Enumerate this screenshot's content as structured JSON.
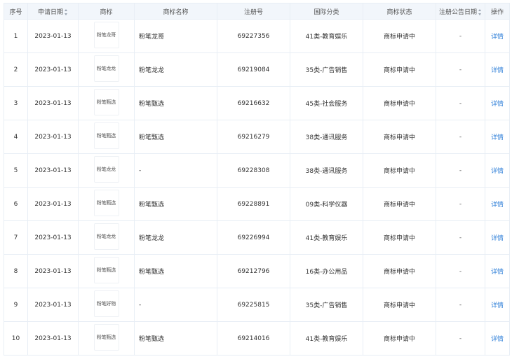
{
  "table": {
    "headers": {
      "index": "序号",
      "apply_date": "申请日期",
      "logo": "商标",
      "name": "商标名称",
      "reg_no": "注册号",
      "category": "国际分类",
      "status": "商标状态",
      "announce_date": "注册公告日期",
      "action": "操作"
    },
    "rows": [
      {
        "index": "1",
        "apply_date": "2023-01-13",
        "logo_text": "粉笔龙哥",
        "name": "粉笔龙哥",
        "reg_no": "69227356",
        "category": "41类-教育娱乐",
        "status": "商标申请中",
        "announce_date": "-",
        "action": "详情"
      },
      {
        "index": "2",
        "apply_date": "2023-01-13",
        "logo_text": "粉笔龙龙",
        "name": "粉笔龙龙",
        "reg_no": "69219084",
        "category": "35类-广告销售",
        "status": "商标申请中",
        "announce_date": "-",
        "action": "详情"
      },
      {
        "index": "3",
        "apply_date": "2023-01-13",
        "logo_text": "粉笔甄选",
        "name": "粉笔甄选",
        "reg_no": "69216632",
        "category": "45类-社会服务",
        "status": "商标申请中",
        "announce_date": "-",
        "action": "详情"
      },
      {
        "index": "4",
        "apply_date": "2023-01-13",
        "logo_text": "粉笔甄选",
        "name": "粉笔甄选",
        "reg_no": "69216279",
        "category": "38类-通讯服务",
        "status": "商标申请中",
        "announce_date": "-",
        "action": "详情"
      },
      {
        "index": "5",
        "apply_date": "2023-01-13",
        "logo_text": "粉笔龙龙",
        "name": "-",
        "reg_no": "69228308",
        "category": "38类-通讯服务",
        "status": "商标申请中",
        "announce_date": "-",
        "action": "详情"
      },
      {
        "index": "6",
        "apply_date": "2023-01-13",
        "logo_text": "粉笔甄选",
        "name": "粉笔甄选",
        "reg_no": "69228891",
        "category": "09类-科学仪器",
        "status": "商标申请中",
        "announce_date": "-",
        "action": "详情"
      },
      {
        "index": "7",
        "apply_date": "2023-01-13",
        "logo_text": "粉笔龙龙",
        "name": "粉笔龙龙",
        "reg_no": "69226994",
        "category": "41类-教育娱乐",
        "status": "商标申请中",
        "announce_date": "-",
        "action": "详情"
      },
      {
        "index": "8",
        "apply_date": "2023-01-13",
        "logo_text": "粉笔甄选",
        "name": "粉笔甄选",
        "reg_no": "69212796",
        "category": "16类-办公用品",
        "status": "商标申请中",
        "announce_date": "-",
        "action": "详情"
      },
      {
        "index": "9",
        "apply_date": "2023-01-13",
        "logo_text": "粉笔好物",
        "name": "-",
        "reg_no": "69225815",
        "category": "35类-广告销售",
        "status": "商标申请中",
        "announce_date": "-",
        "action": "详情"
      },
      {
        "index": "10",
        "apply_date": "2023-01-13",
        "logo_text": "粉笔甄选",
        "name": "粉笔甄选",
        "reg_no": "69214016",
        "category": "41类-教育娱乐",
        "status": "商标申请中",
        "announce_date": "-",
        "action": "详情"
      }
    ]
  }
}
